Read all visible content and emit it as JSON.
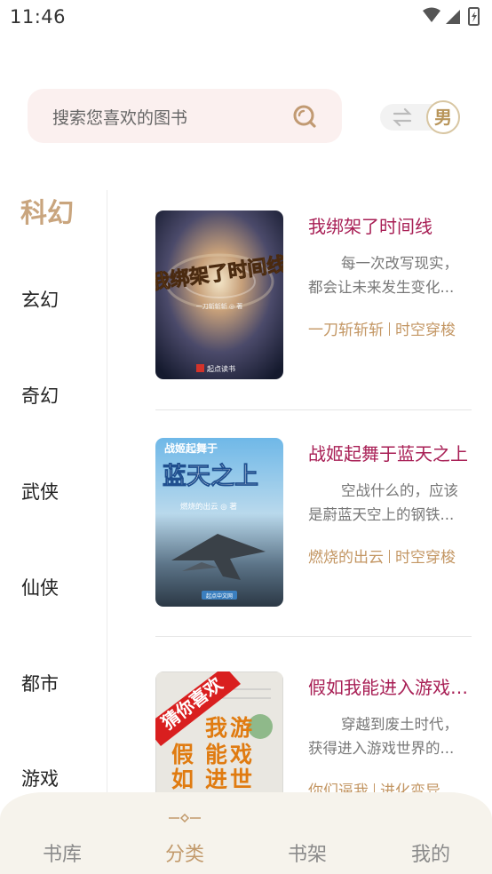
{
  "status_bar": {
    "time": "11:46",
    "icons": [
      "wifi-icon",
      "cell-signal-icon",
      "battery-icon"
    ]
  },
  "search": {
    "placeholder": "搜索您喜欢的图书",
    "icon": "search-icon"
  },
  "gender_toggle": {
    "label": "男",
    "icon": "swap-icon"
  },
  "categories": {
    "active": "科幻",
    "items": [
      "玄幻",
      "奇幻",
      "武侠",
      "仙侠",
      "都市",
      "游戏"
    ]
  },
  "books": [
    {
      "title": "我绑架了时间线",
      "desc": "每一次改写现实，都会让未来发生变化...",
      "author": "一刀斩斩斩",
      "genre": "时空穿梭",
      "cover": {
        "title": "我绑架了时间线",
        "author_line": "一刀斩斩斩 ◎ 著",
        "publisher": "起点读书"
      }
    },
    {
      "title": "战姬起舞于蓝天之上",
      "desc": "空战什么的，应该是蔚蓝天空上的钢铁...",
      "author": "燃烧的出云",
      "genre": "时空穿梭",
      "cover": {
        "title_top": "战姬起舞于",
        "title_main": "蓝天之上",
        "author_line": "燃烧的出云 ◎ 著",
        "publisher": "起点中文网"
      }
    },
    {
      "title": "假如我能进入游戏世界",
      "desc": "穿越到废土时代，获得进入游戏世界的...",
      "author": "你们逼我",
      "genre": "进化变异",
      "cover": {
        "banner": "猜你喜欢",
        "chars": [
          "我",
          "游",
          "假",
          "能",
          "戏",
          "如",
          "进",
          "世"
        ]
      }
    }
  ],
  "bottom_nav": {
    "active": "分类",
    "tabs": [
      "书库",
      "分类",
      "书架",
      "我的"
    ]
  },
  "colors": {
    "accent": "#c29a6c",
    "title": "#a81f55",
    "search_bg": "#fbf0ef",
    "nav_bg": "#f6f3ec"
  }
}
